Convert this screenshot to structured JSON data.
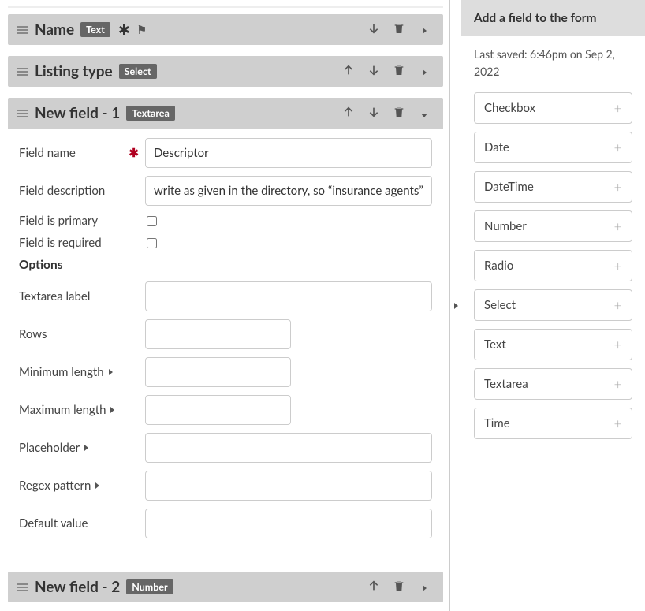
{
  "sidebar": {
    "title": "Add a field to the form",
    "last_saved": "Last saved: 6:46pm on Sep 2, 2022",
    "field_types": [
      "Checkbox",
      "Date",
      "DateTime",
      "Number",
      "Radio",
      "Select",
      "Text",
      "Textarea",
      "Time"
    ]
  },
  "fields": [
    {
      "title": "Name",
      "badge": "Text",
      "show_up": false,
      "show_down": true,
      "expanded": false,
      "required_flag": true,
      "primary_flag": true
    },
    {
      "title": "Listing type",
      "badge": "Select",
      "show_up": true,
      "show_down": true,
      "expanded": false
    },
    {
      "title": "New field - 1",
      "badge": "Textarea",
      "show_up": true,
      "show_down": true,
      "expanded": true
    },
    {
      "title": "New field - 2",
      "badge": "Number",
      "show_up": true,
      "show_down": false,
      "expanded": false
    }
  ],
  "edit": {
    "labels": {
      "field_name": "Field name",
      "field_description": "Field description",
      "field_primary": "Field is primary",
      "field_required": "Field is required",
      "options": "Options",
      "textarea_label": "Textarea label",
      "rows": "Rows",
      "min_len": "Minimum length",
      "max_len": "Maximum length",
      "placeholder": "Placeholder",
      "regex": "Regex pattern",
      "default": "Default value"
    },
    "values": {
      "field_name": "Descriptor",
      "field_description": "write as given in the directory, so “insurance agents”",
      "field_primary": false,
      "field_required": false,
      "textarea_label": "",
      "rows": "",
      "min_len": "",
      "max_len": "",
      "placeholder": "",
      "regex": "",
      "default": ""
    }
  }
}
